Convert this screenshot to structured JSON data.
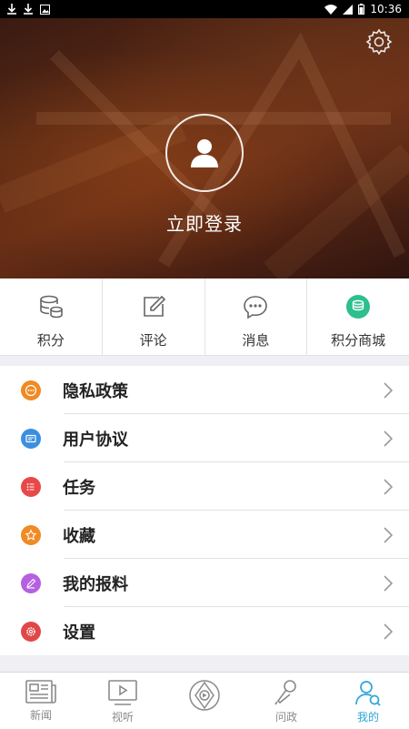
{
  "status_bar": {
    "time": "10:36",
    "left_icons": [
      "download-icon",
      "download-icon",
      "image-icon"
    ],
    "right_icons": [
      "wifi-icon",
      "signal-icon",
      "battery-icon"
    ]
  },
  "header": {
    "login_text": "立即登录",
    "settings_icon": "gear-icon",
    "avatar_icon": "user-icon"
  },
  "quick_actions": [
    {
      "label": "积分",
      "icon": "database-icon",
      "color": "#666666"
    },
    {
      "label": "评论",
      "icon": "edit-icon",
      "color": "#666666"
    },
    {
      "label": "消息",
      "icon": "chat-icon",
      "color": "#666666"
    },
    {
      "label": "积分商城",
      "icon": "coins-icon",
      "color": "#2dbf8e"
    }
  ],
  "menu": [
    {
      "label": "隐私政策",
      "icon": "privacy-icon",
      "color": "#f08a24"
    },
    {
      "label": "用户协议",
      "icon": "agreement-icon",
      "color": "#3b8fe0"
    },
    {
      "label": "任务",
      "icon": "task-list-icon",
      "color": "#e84848"
    },
    {
      "label": "收藏",
      "icon": "star-icon",
      "color": "#f08a24"
    },
    {
      "label": "我的报料",
      "icon": "pencil-icon",
      "color": "#b560e0"
    },
    {
      "label": "设置",
      "icon": "gear-icon",
      "color": "#e04848"
    }
  ],
  "tabbar": [
    {
      "label": "新闻",
      "icon": "newspaper-icon",
      "active": false
    },
    {
      "label": "视听",
      "icon": "video-icon",
      "active": false
    },
    {
      "label": "",
      "icon": "emblem-icon",
      "active": false
    },
    {
      "label": "问政",
      "icon": "microphone-icon",
      "active": false
    },
    {
      "label": "我的",
      "icon": "profile-icon",
      "active": true
    }
  ],
  "colors": {
    "active_tab": "#2aa6d8",
    "inactive_tab": "#8a8a8a",
    "background": "#efeff4"
  }
}
